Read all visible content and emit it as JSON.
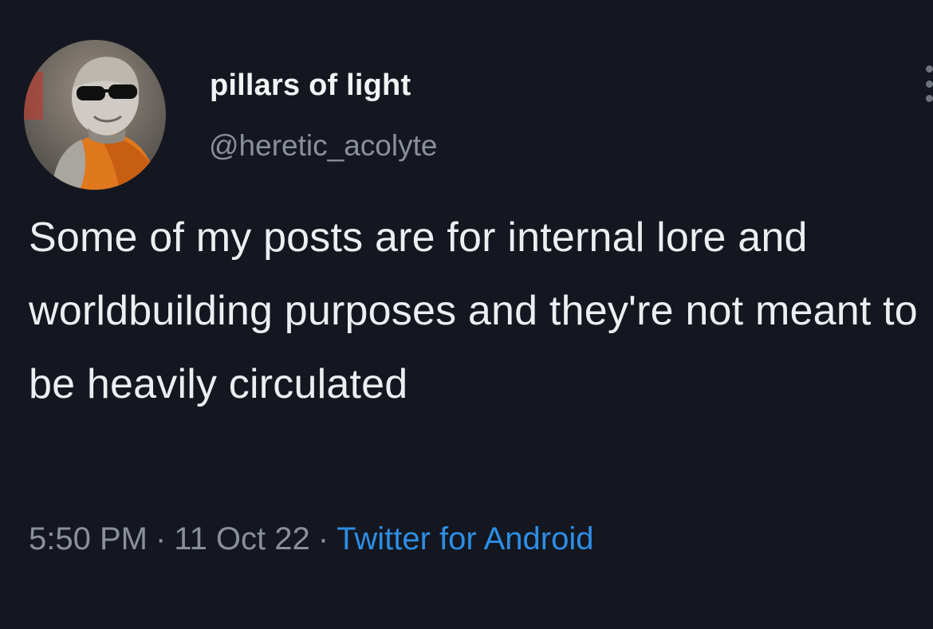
{
  "tweet": {
    "display_name": "pillars of light",
    "handle": "@heretic_acolyte",
    "text": "Some of my posts are for internal lore and worldbuilding purposes and they're not meant to be heavily circulated",
    "time": "5:50 PM",
    "date": "11 Oct 22",
    "separator": "·",
    "source": "Twitter for Android"
  },
  "icons": {
    "avatar": "robed-figure-with-sunglasses-avatar",
    "more": "more-options-icon"
  },
  "colors": {
    "background": "#14171f",
    "primary_text": "#eceef1",
    "secondary_text": "#8a9099",
    "link": "#2d8ee6"
  }
}
